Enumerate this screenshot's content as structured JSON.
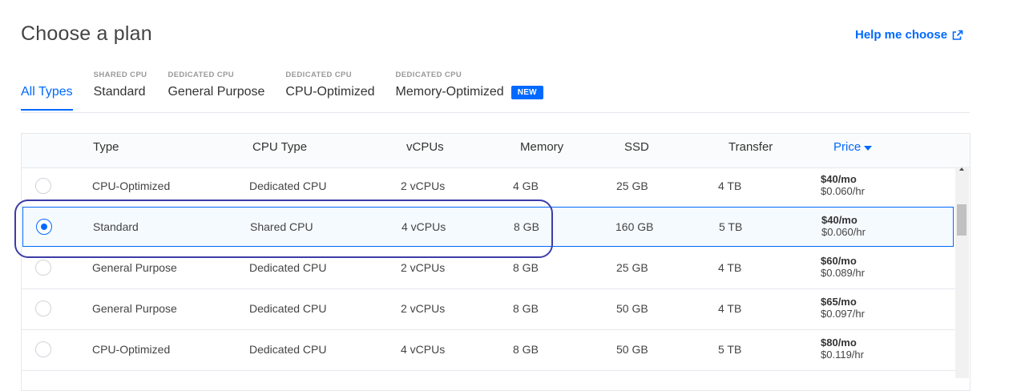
{
  "header": {
    "title": "Choose a plan",
    "help_link": "Help me choose"
  },
  "tabs": [
    {
      "category": "",
      "label": "All Types",
      "badge": ""
    },
    {
      "category": "SHARED CPU",
      "label": "Standard",
      "badge": ""
    },
    {
      "category": "DEDICATED CPU",
      "label": "General Purpose",
      "badge": ""
    },
    {
      "category": "DEDICATED CPU",
      "label": "CPU-Optimized",
      "badge": ""
    },
    {
      "category": "DEDICATED CPU",
      "label": "Memory-Optimized",
      "badge": "NEW"
    }
  ],
  "table": {
    "columns": [
      "Type",
      "CPU Type",
      "vCPUs",
      "Memory",
      "SSD",
      "Transfer",
      "Price"
    ],
    "rows": [
      {
        "type": "CPU-Optimized",
        "cpu": "Dedicated CPU",
        "vcpus": "2 vCPUs",
        "memory": "4 GB",
        "ssd": "25 GB",
        "transfer": "4 TB",
        "monthly": "$40/mo",
        "hourly": "$0.060/hr",
        "selected": false
      },
      {
        "type": "Standard",
        "cpu": "Shared CPU",
        "vcpus": "4 vCPUs",
        "memory": "8 GB",
        "ssd": "160 GB",
        "transfer": "5 TB",
        "monthly": "$40/mo",
        "hourly": "$0.060/hr",
        "selected": true
      },
      {
        "type": "General Purpose",
        "cpu": "Dedicated CPU",
        "vcpus": "2 vCPUs",
        "memory": "8 GB",
        "ssd": "25 GB",
        "transfer": "4 TB",
        "monthly": "$60/mo",
        "hourly": "$0.089/hr",
        "selected": false
      },
      {
        "type": "General Purpose",
        "cpu": "Dedicated CPU",
        "vcpus": "2 vCPUs",
        "memory": "8 GB",
        "ssd": "50 GB",
        "transfer": "4 TB",
        "monthly": "$65/mo",
        "hourly": "$0.097/hr",
        "selected": false
      },
      {
        "type": "CPU-Optimized",
        "cpu": "Dedicated CPU",
        "vcpus": "4 vCPUs",
        "memory": "8 GB",
        "ssd": "50 GB",
        "transfer": "5 TB",
        "monthly": "$80/mo",
        "hourly": "$0.119/hr",
        "selected": false
      }
    ]
  },
  "colors": {
    "accent": "#0069ff",
    "highlight_outline": "#3c3ca8"
  },
  "icons": {
    "help": "external-link-icon",
    "sort": "caret-down-icon"
  }
}
